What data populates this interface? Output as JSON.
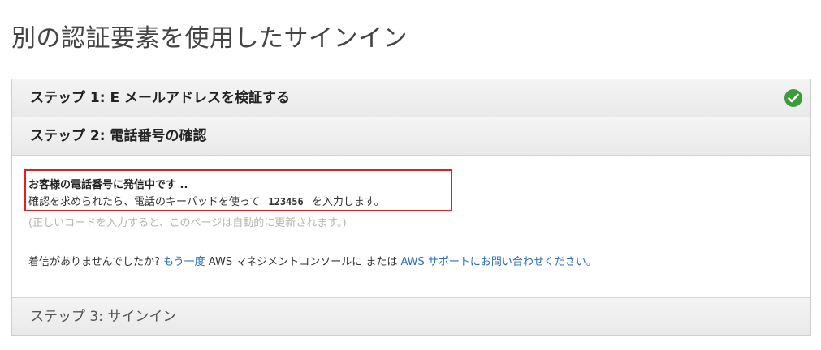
{
  "page": {
    "title": "別の認証要素を使用したサインイン"
  },
  "steps": {
    "step1": {
      "label": "ステップ 1: E メールアドレスを検証する",
      "status_icon": "check-circle-icon",
      "status_color": "#3c9b3c"
    },
    "step2": {
      "label": "ステップ 2: 電話番号の確認"
    },
    "step3": {
      "label": "ステップ 3: サインイン"
    }
  },
  "verification": {
    "calling_title": "お客様の電話番号に発信中です ..",
    "instruction_before": "確認を求められたら、電話のキーパッドを使って",
    "pin": "123456",
    "instruction_after": "を入力します。",
    "refresh_note": "(正しいコードを入力すると、このページは自動的に更新されます。)",
    "no_call_prefix": "着信がありませんでしたか?",
    "retry_link": "もう一度",
    "no_call_middle": "AWS マネジメントコンソールに または",
    "support_link": "AWS サポートにお問い合わせください。"
  },
  "colors": {
    "highlight_border": "#e02020",
    "link": "#2a6fb5"
  }
}
